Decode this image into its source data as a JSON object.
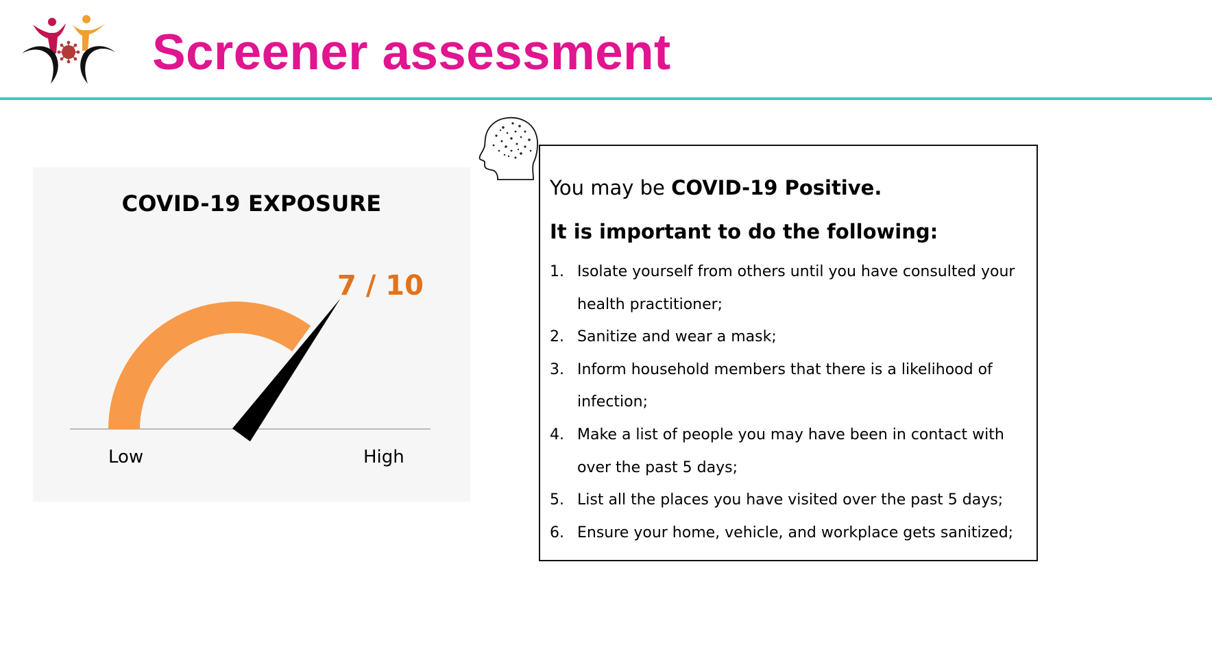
{
  "header": {
    "title": "Screener assessment",
    "title_color": "#e0158f",
    "rule_color": "#3cc8c4",
    "logo_icon": "people-virus-logo-icon"
  },
  "gauge": {
    "title": "COVID-19 EXPOSURE",
    "score_label": "7 / 10",
    "score_value": 7,
    "score_max": 10,
    "low_label": "Low",
    "high_label": "High",
    "arc_color": "#f79a4a",
    "score_color": "#e0731d",
    "needle_color": "#000000"
  },
  "advice": {
    "head_icon": "head-brain-icon",
    "lead_text": "You may be ",
    "lead_bold": "COVID-19 Positive.",
    "heading": "It is important to do the following:",
    "items": [
      {
        "num": "1.",
        "text": "Isolate yourself from others until you have consulted your health practitioner;"
      },
      {
        "num": "2.",
        "text": "Sanitize and wear a mask;"
      },
      {
        "num": "3.",
        "text": "Inform household members that there is a likelihood of infection;"
      },
      {
        "num": "4.",
        "text": "Make a list of people you may have been in contact with over the past 5 days;"
      },
      {
        "num": "5.",
        "text": "List all the places you have visited over the past 5 days;"
      },
      {
        "num": "6.",
        "text": "Ensure your home, vehicle, and workplace gets sanitized;"
      }
    ]
  }
}
